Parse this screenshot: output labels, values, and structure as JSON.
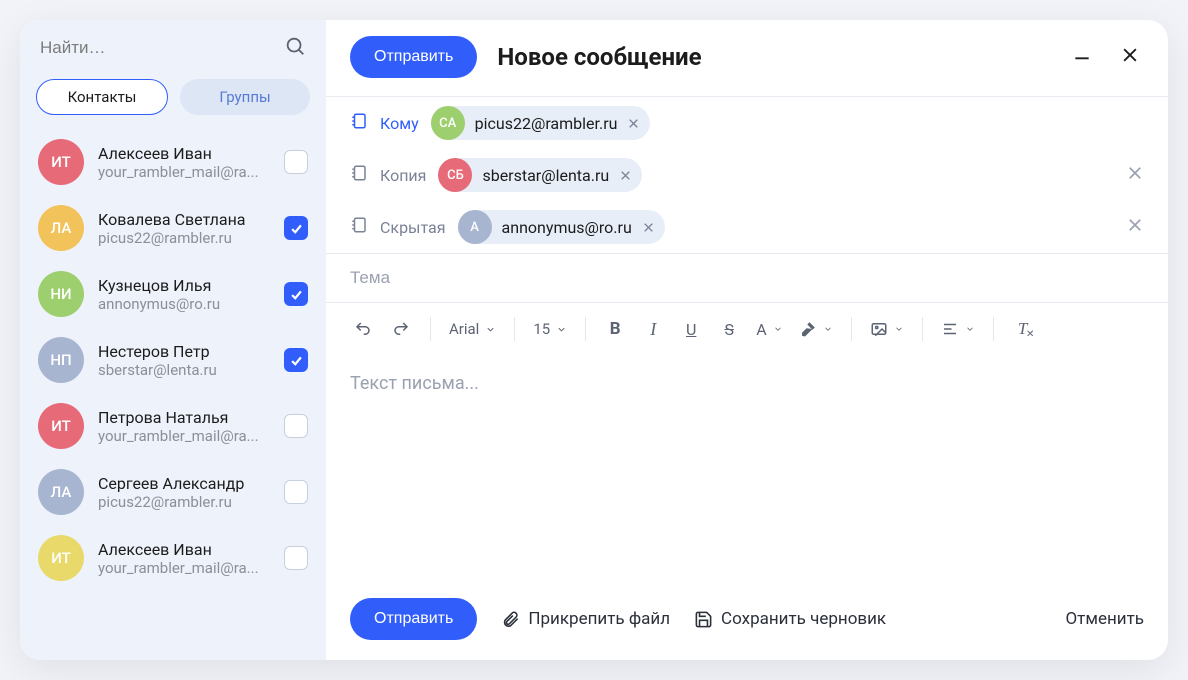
{
  "sidebar": {
    "search_placeholder": "Найти…",
    "tabs": {
      "contacts": "Контакты",
      "groups": "Группы"
    },
    "contacts": [
      {
        "initials": "ИТ",
        "color": "#e76a78",
        "name": "Алексеев Иван",
        "email": "your_rambler_mail@ra...",
        "checked": false
      },
      {
        "initials": "ЛА",
        "color": "#f2c35b",
        "name": "Ковалева Светлана",
        "email": "picus22@rambler.ru",
        "checked": true
      },
      {
        "initials": "НИ",
        "color": "#9dcf6f",
        "name": "Кузнецов Илья",
        "email": "annonymus@ro.ru",
        "checked": true
      },
      {
        "initials": "НП",
        "color": "#a7b5d0",
        "name": "Нестеров Петр",
        "email": "sberstar@lenta.ru",
        "checked": true
      },
      {
        "initials": "ИТ",
        "color": "#e76a78",
        "name": "Петрова Наталья",
        "email": "your_rambler_mail@ra...",
        "checked": false
      },
      {
        "initials": "ЛА",
        "color": "#a7b5d0",
        "name": "Сергеев Александр",
        "email": "picus22@rambler.ru",
        "checked": false
      },
      {
        "initials": "ИТ",
        "color": "#e8d96a",
        "name": "Алексеев Иван",
        "email": "your_rambler_mail@ra...",
        "checked": false
      }
    ]
  },
  "compose": {
    "send": "Отправить",
    "title": "Новое сообщение",
    "to_label": "Кому",
    "cc_label": "Копия",
    "bcc_label": "Скрытая",
    "to_chip": {
      "initials": "CA",
      "color": "#9dcf6f",
      "email": "picus22@rambler.ru"
    },
    "cc_chip": {
      "initials": "СБ",
      "color": "#e76a78",
      "email": "sberstar@lenta.ru"
    },
    "bcc_chip": {
      "initials": "A",
      "color": "#a7b5d0",
      "email": "annonymus@ro.ru"
    },
    "subject_placeholder": "Тема",
    "body_placeholder": "Текст письма...",
    "toolbar": {
      "font": "Arial",
      "size": "15"
    },
    "footer": {
      "send": "Отправить",
      "attach": "Прикрепить файл",
      "draft": "Сохранить черновик",
      "cancel": "Отменить"
    }
  }
}
